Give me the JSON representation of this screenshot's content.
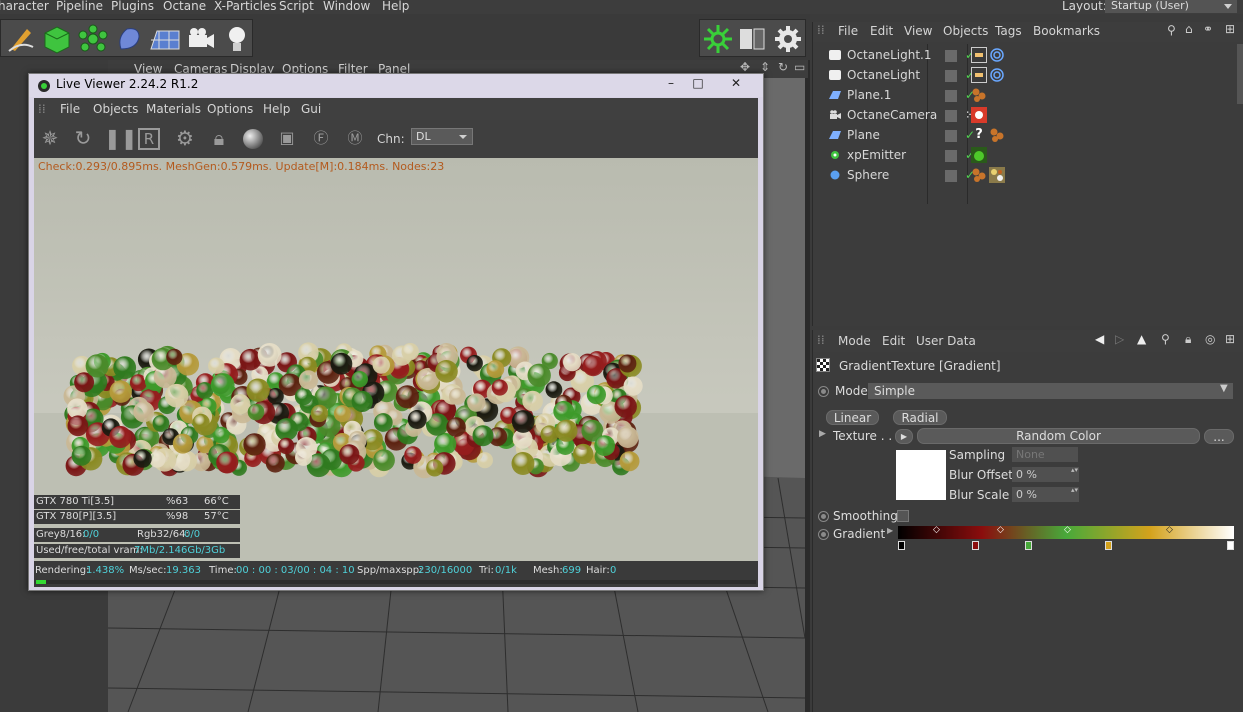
{
  "menubar": {
    "items": [
      "haracter",
      "Pipeline",
      "Plugins",
      "Octane",
      "X-Particles",
      "Script",
      "Window",
      "Help"
    ],
    "layout_label": "Layout:",
    "layout_value": "Startup (User)"
  },
  "viewport": {
    "menu": [
      "View",
      "Cameras",
      "Display",
      "Options",
      "Filter",
      "Panel"
    ]
  },
  "live_viewer": {
    "title": "Live Viewer 2.24.2 R1.2",
    "window_buttons": [
      "–",
      "□",
      "✕"
    ],
    "menu": [
      "File",
      "Objects",
      "Materials",
      "Options",
      "Help",
      "Gui"
    ],
    "channel_label": "Chn:",
    "channel_value": "DL",
    "check_text": "Check:0.293/0.895ms. MeshGen:0.579ms. Update[M]:0.184ms. Nodes:23",
    "gpus": [
      {
        "name": "GTX 780 Ti[3.5]",
        "usage": "%63",
        "temp": "66°C"
      },
      {
        "name": "GTX 780[P][3.5]",
        "usage": "%98",
        "temp": "57°C"
      }
    ],
    "grey_label": "Grey8/16:",
    "grey_value": "0/0",
    "rgb_label": "Rgb32/64:",
    "rgb_value": "0/0",
    "vram_label": "Used/free/total vram:",
    "vram_value": "7Mb/2.146Gb/3Gb",
    "status": {
      "rendering_label": "Rendering:",
      "rendering_value": "1.438%",
      "ms_label": "Ms/sec:",
      "ms_value": "19.363",
      "time_label": "Time:",
      "time_value": "00 : 00 : 03/00 : 04 : 10",
      "spp_label": "Spp/maxspp:",
      "spp_value": "230/16000",
      "tri_label": "Tri:",
      "tri_value": "0/1k",
      "mesh_label": "Mesh:",
      "mesh_value": "699",
      "hair_label": "Hair:",
      "hair_value": "0"
    },
    "progress": 0.01438
  },
  "object_manager": {
    "menu": [
      "File",
      "Edit",
      "View",
      "Objects",
      "Tags",
      "Bookmarks"
    ],
    "objects": [
      {
        "name": "OctaneLight.1",
        "icon": "light-icon"
      },
      {
        "name": "OctaneLight",
        "icon": "light-icon"
      },
      {
        "name": "Plane.1",
        "icon": "plane-icon"
      },
      {
        "name": "OctaneCamera",
        "icon": "camera-icon"
      },
      {
        "name": "Plane",
        "icon": "plane-icon"
      },
      {
        "name": "xpEmitter",
        "icon": "emitter-icon"
      },
      {
        "name": "Sphere",
        "icon": "sphere-icon"
      }
    ]
  },
  "attribute_manager": {
    "menu": [
      "Mode",
      "Edit",
      "User Data"
    ],
    "header": "GradientTexture [Gradient]",
    "mode_label": "Mode",
    "mode_value": "Simple",
    "linear_label": "Linear",
    "radial_label": "Radial",
    "texture_label": "Texture . . .",
    "texture_value": "Random Color",
    "texture_more": "...",
    "sampling_label": "Sampling",
    "sampling_value": "None",
    "blur_offset_label": "Blur Offset",
    "blur_offset_value": "0 %",
    "blur_scale_label": "Blur Scale",
    "blur_scale_value": "0 %",
    "smoothing_label": "Smoothing",
    "gradient_label": "Gradient",
    "gradient_colors": [
      "#000000",
      "#8b0d0d",
      "#48a93a",
      "#d4a21c",
      "#ffffff"
    ]
  }
}
